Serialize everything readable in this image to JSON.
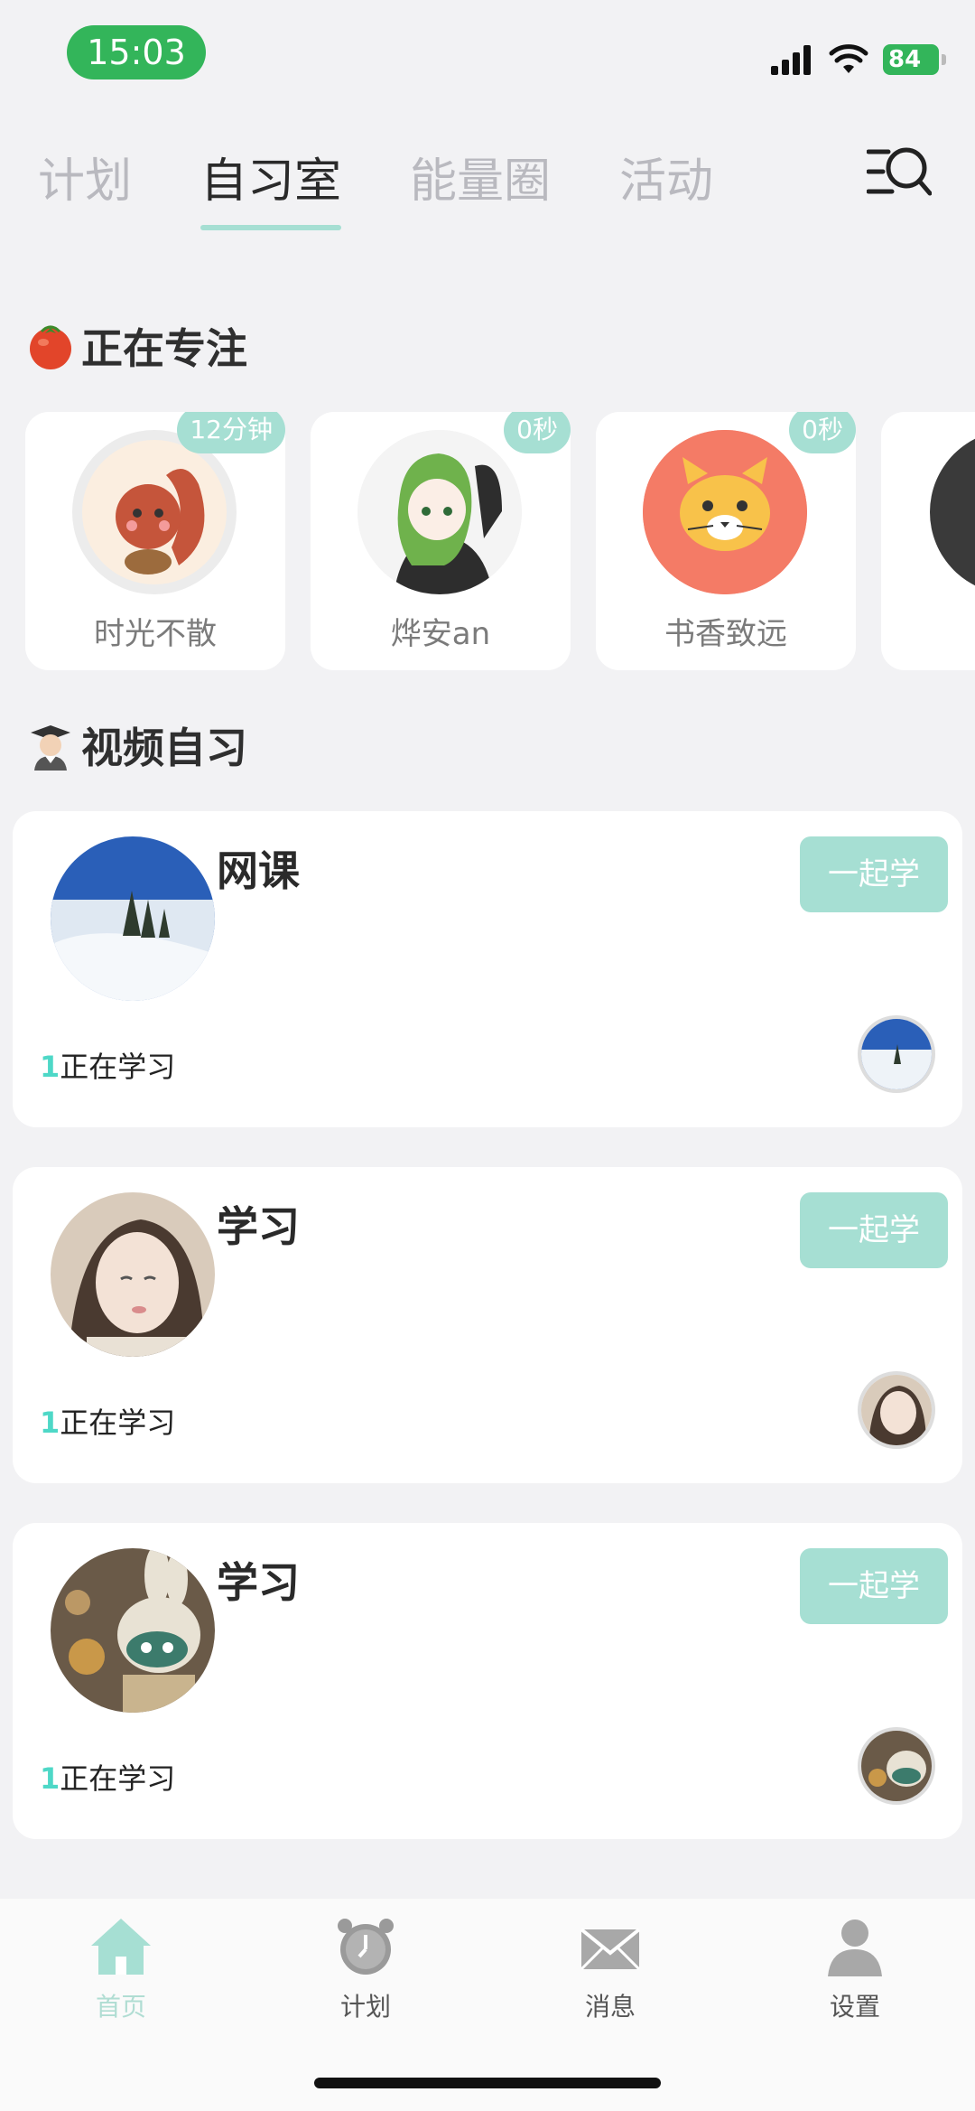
{
  "status_bar": {
    "time": "15:03",
    "battery": "84"
  },
  "tabs": [
    {
      "label": "计划"
    },
    {
      "label": "自习室",
      "active": true
    },
    {
      "label": "能量圈"
    },
    {
      "label": "活动"
    }
  ],
  "focusing": {
    "title": "正在专注",
    "users": [
      {
        "name": "时光不散",
        "duration": "12分钟"
      },
      {
        "name": "烨安an",
        "duration": "0秒"
      },
      {
        "name": "书香致远",
        "duration": "0秒"
      }
    ]
  },
  "video_study": {
    "title": "视频自习",
    "rooms": [
      {
        "title": "网课",
        "join_label": "一起学",
        "count": "1",
        "count_label": "正在学习"
      },
      {
        "title": "学习",
        "join_label": "一起学",
        "count": "1",
        "count_label": "正在学习"
      },
      {
        "title": "学习",
        "join_label": "一起学",
        "count": "1",
        "count_label": "正在学习"
      }
    ]
  },
  "bottom_nav": [
    {
      "label": "首页",
      "icon": "home-icon",
      "active": true
    },
    {
      "label": "计划",
      "icon": "alarm-clock-icon"
    },
    {
      "label": "消息",
      "icon": "envelope-icon"
    },
    {
      "label": "设置",
      "icon": "person-icon"
    }
  ],
  "colors": {
    "accent": "#a6dfd3",
    "status_green": "#33b55a",
    "count_cyan": "#4ed8c7"
  }
}
